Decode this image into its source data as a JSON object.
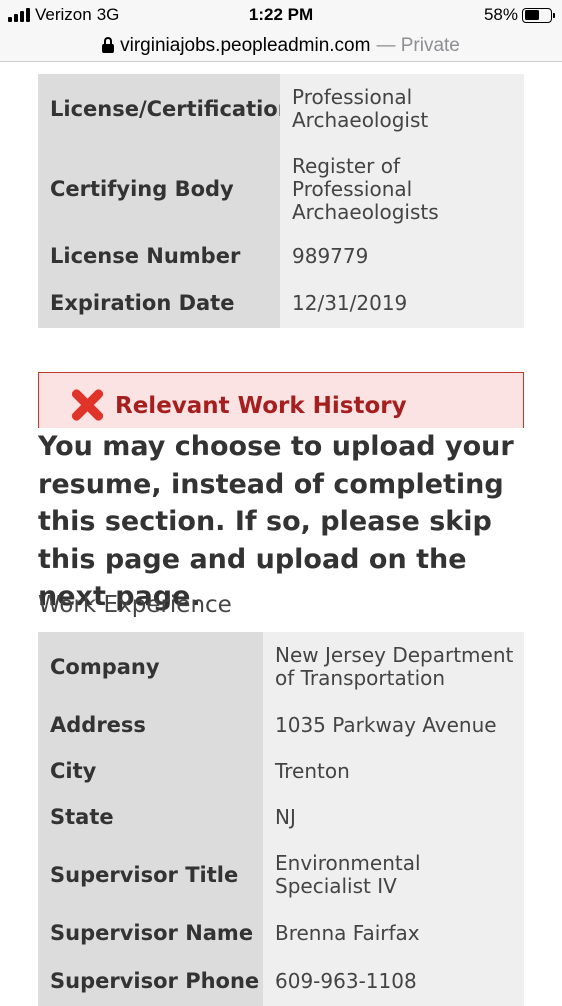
{
  "status_bar": {
    "carrier": "Verizon",
    "network": "3G",
    "time": "1:22 PM",
    "battery": "58%",
    "battery_level": 0.58
  },
  "url_bar": {
    "host": "virginiajobs.peopleadmin.com",
    "mode": "— Private"
  },
  "license_table": {
    "rows": [
      {
        "label": "License/Certification",
        "value": "Professional Archaeologist"
      },
      {
        "label": "Certifying Body",
        "value": "Register of Professional Archaeologists"
      },
      {
        "label": "License Number",
        "value": "989779"
      },
      {
        "label": "Expiration Date",
        "value": "12/31/2019"
      }
    ]
  },
  "error": {
    "title": "Relevant Work History",
    "icon": "error-x-icon",
    "icon_color": "#e0332a"
  },
  "instructions": "You may choose to upload your resume, instead of completing this section. If so, please skip this page and upload on the next page.",
  "work_experience": {
    "heading": "Work Experience",
    "rows": [
      {
        "label": "Company",
        "value": "New Jersey Department of Transportation"
      },
      {
        "label": "Address",
        "value": "1035 Parkway Avenue"
      },
      {
        "label": "City",
        "value": "Trenton"
      },
      {
        "label": "State",
        "value": "NJ"
      },
      {
        "label": "Supervisor Title",
        "value": "Environmental Specialist IV"
      },
      {
        "label": "Supervisor Name",
        "value": "Brenna Fairfax"
      },
      {
        "label": "Supervisor Phone",
        "value": "609-963-1108"
      }
    ]
  },
  "colors": {
    "link": "#2e6fa7",
    "error_text": "#a61f1f",
    "error_background": "#fbe3e4"
  }
}
